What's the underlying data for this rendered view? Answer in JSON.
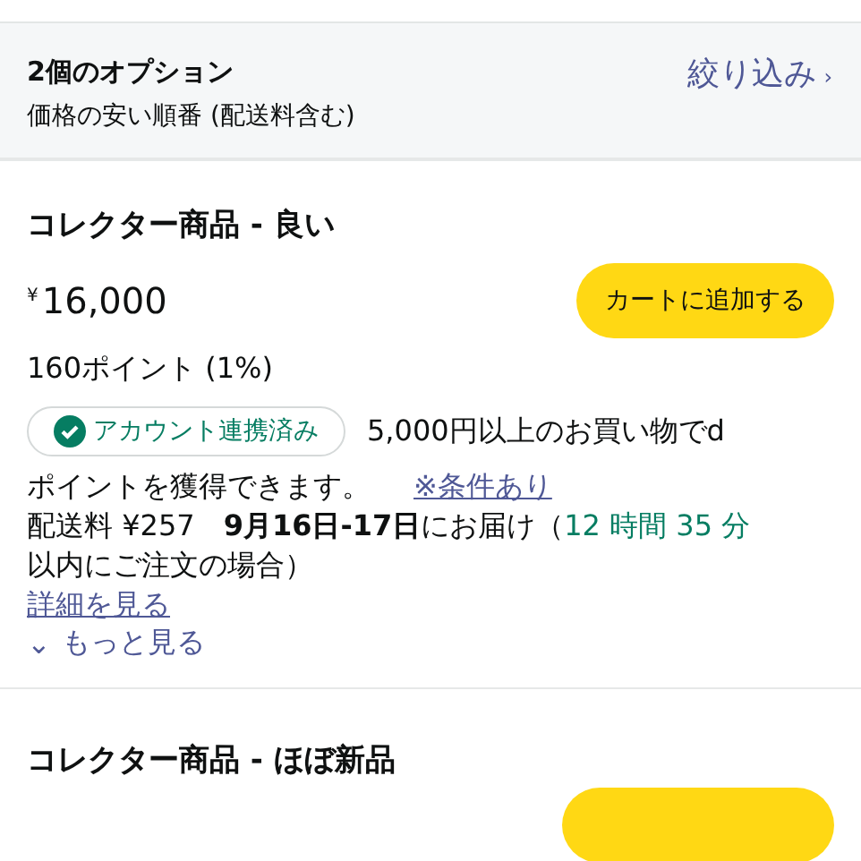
{
  "header": {
    "title": "2個のオプション",
    "subtitle": "価格の安い順番 (配送料含む)",
    "filter_link": "絞り込み",
    "filter_chevron": "›"
  },
  "offers": [
    {
      "title": "コレクター商品 - 良い",
      "currency": "¥",
      "price": "16,000",
      "button": "カートに追加する",
      "points": "160ポイント (1%)",
      "badge": {
        "label": "アカウント連携済み",
        "verified": true
      },
      "promo_line1": "5,000円以上のお買い物でd",
      "promo_line2": "ポイントを獲得できます。",
      "conditions_link": "※条件あり",
      "shipping_fee": "配送料 ¥257",
      "delivery": "**9月16日-17日**にお届け（",
      "countdown": "12 時間 35 分",
      "delivery_tail": "以内にご注文の場合）",
      "details_link": "詳細を見る",
      "more_chevron": "⌄",
      "more_link": "もっと見る"
    },
    {
      "title": "コレクター商品 - ほぼ新品",
      "button_partial": true
    }
  ]
}
